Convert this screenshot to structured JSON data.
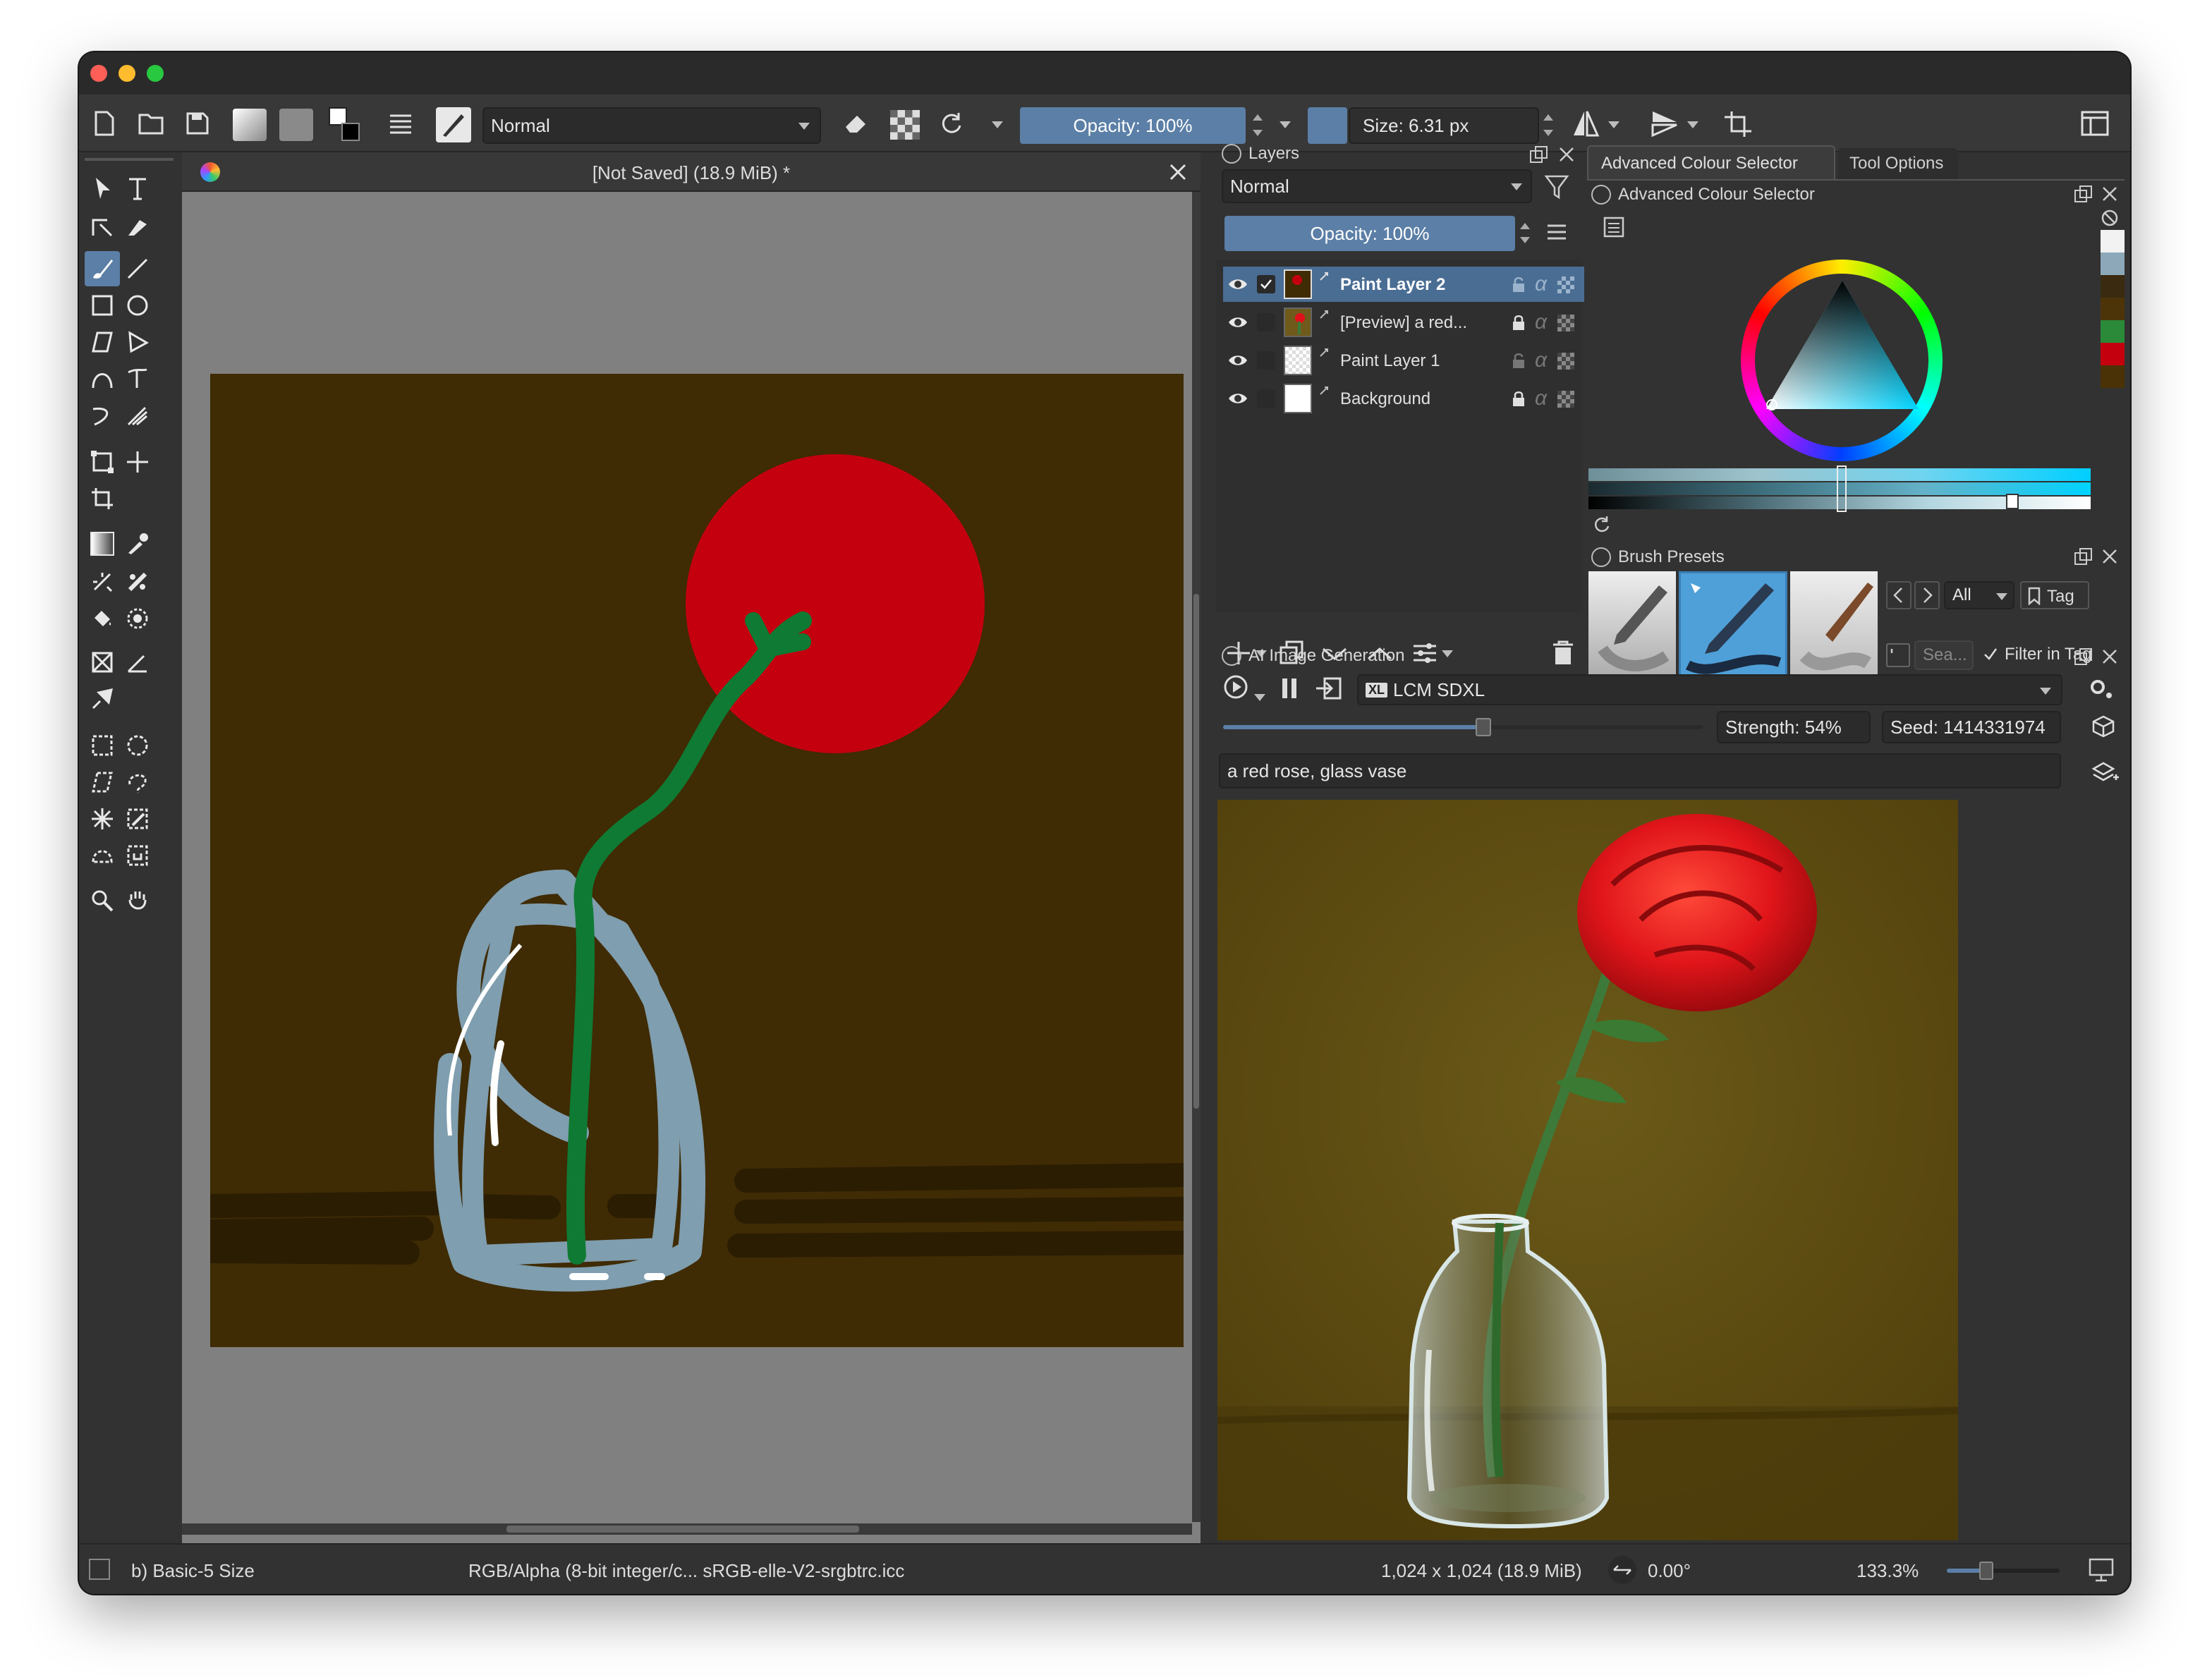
{
  "toolbar": {
    "blend_mode": "Normal",
    "opacity_label": "Opacity: 100%",
    "size_label": "Size: 6.31 px"
  },
  "document_tab": {
    "title": "[Not Saved]  (18.9 MiB) *"
  },
  "layers_panel": {
    "title": "Layers",
    "blend_mode": "Normal",
    "opacity_label": "Opacity:  100%",
    "layers": [
      {
        "name": "Paint Layer 2",
        "selected": true,
        "visible": true
      },
      {
        "name": "[Preview] a red...",
        "selected": false,
        "visible": true
      },
      {
        "name": "Paint Layer 1",
        "selected": false,
        "visible": true
      },
      {
        "name": "Background",
        "selected": false,
        "visible": true
      }
    ]
  },
  "colour_panel": {
    "tab_active": "Advanced Colour Selector",
    "tab_other": "Tool Options",
    "title": "Advanced Colour Selector",
    "history_colors": [
      "#f2f2f2",
      "#8da8b8",
      "#3a2a10",
      "#4d3408",
      "#2a8a3a",
      "#c4000f",
      "#4a3206"
    ]
  },
  "brush_presets": {
    "title": "Brush Presets",
    "filter_value": "All",
    "tag_label": "Tag",
    "search_placeholder": "Sea...",
    "filter_in_tag_label": "Filter in Tag"
  },
  "ai_panel": {
    "title": "AI Image Generation",
    "model": "LCM SDXL",
    "strength_label": "Strength: 54%",
    "seed_label": "Seed: 1414331974",
    "strength_value": 0.54,
    "prompt": "a red rose, glass vase"
  },
  "status": {
    "brush": "b) Basic-5 Size",
    "color_space": "RGB/Alpha (8-bit integer/c...  sRGB-elle-V2-srgbtrc.icc",
    "dimensions": "1,024 x 1,024 (18.9 MiB)",
    "rotation": "0.00°",
    "zoom": "133.3%"
  },
  "colors": {
    "window_bg": "#323232",
    "accent": "#5b7fa6",
    "canvas_brown": "#3f2b04",
    "rose_red": "#c4000f",
    "stem_green": "#0f7a33",
    "vase_blue": "#7f9eaf"
  }
}
